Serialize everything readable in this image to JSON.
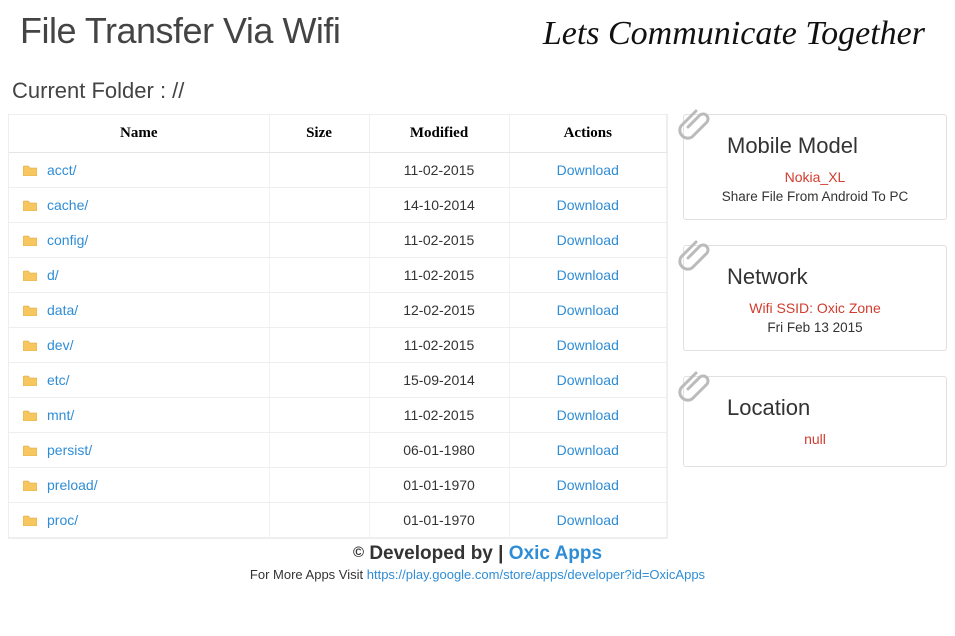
{
  "header": {
    "title": "File Transfer Via Wifi",
    "tagline": "Lets Communicate Together"
  },
  "breadcrumb": {
    "label": "Current Folder : //"
  },
  "table": {
    "columns": {
      "name": "Name",
      "size": "Size",
      "modified": "Modified",
      "actions": "Actions"
    },
    "download_label": "Download",
    "rows": [
      {
        "name": "acct/",
        "size": "",
        "modified": "11-02-2015"
      },
      {
        "name": "cache/",
        "size": "",
        "modified": "14-10-2014"
      },
      {
        "name": "config/",
        "size": "",
        "modified": "11-02-2015"
      },
      {
        "name": "d/",
        "size": "",
        "modified": "11-02-2015"
      },
      {
        "name": "data/",
        "size": "",
        "modified": "12-02-2015"
      },
      {
        "name": "dev/",
        "size": "",
        "modified": "11-02-2015"
      },
      {
        "name": "etc/",
        "size": "",
        "modified": "15-09-2014"
      },
      {
        "name": "mnt/",
        "size": "",
        "modified": "11-02-2015"
      },
      {
        "name": "persist/",
        "size": "",
        "modified": "06-01-1980"
      },
      {
        "name": "preload/",
        "size": "",
        "modified": "01-01-1970"
      },
      {
        "name": "proc/",
        "size": "",
        "modified": "01-01-1970"
      }
    ]
  },
  "cards": {
    "mobile": {
      "title": "Mobile Model",
      "value": "Nokia_XL",
      "sub": "Share File From Android To PC"
    },
    "network": {
      "title": "Network",
      "value": "Wifi SSID: Oxic Zone",
      "sub": "Fri Feb 13 2015"
    },
    "location": {
      "title": "Location",
      "value": "null"
    }
  },
  "footer": {
    "dev_prefix": "Developed by | ",
    "dev_link": "Oxic Apps",
    "more_prefix": "For More Apps Visit ",
    "more_url": "https://play.google.com/store/apps/developer?id=OxicApps"
  }
}
